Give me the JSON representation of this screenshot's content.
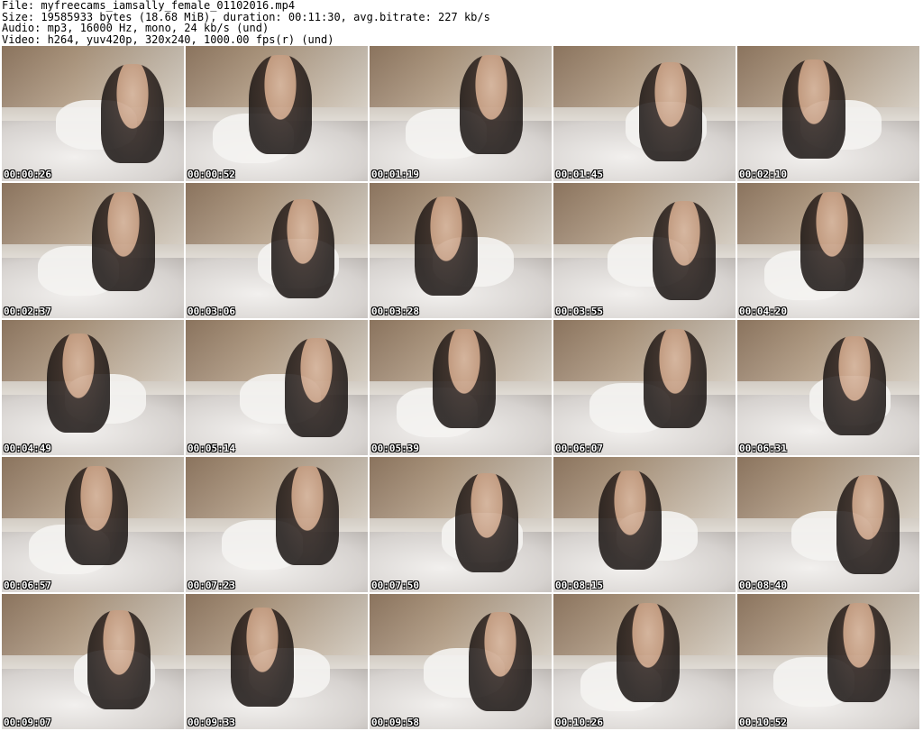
{
  "header": {
    "file": "File: myfreecams_iamsally_female_01102016.mp4",
    "size": "Size: 19585933 bytes (18.68 MiB), duration: 00:11:30, avg.bitrate: 227 kb/s",
    "audio": "Audio: mp3, 16000 Hz, mono, 24 kb/s (und)",
    "video": "Video: h264, yuv420p, 320x240, 1000.00 fps(r) (und)"
  },
  "thumbnails": [
    {
      "timestamp": "00:00:26"
    },
    {
      "timestamp": "00:00:52"
    },
    {
      "timestamp": "00:01:19"
    },
    {
      "timestamp": "00:01:45"
    },
    {
      "timestamp": "00:02:10"
    },
    {
      "timestamp": "00:02:37"
    },
    {
      "timestamp": "00:03:06"
    },
    {
      "timestamp": "00:03:28"
    },
    {
      "timestamp": "00:03:55"
    },
    {
      "timestamp": "00:04:20"
    },
    {
      "timestamp": "00:04:49"
    },
    {
      "timestamp": "00:05:14"
    },
    {
      "timestamp": "00:05:39"
    },
    {
      "timestamp": "00:06:07"
    },
    {
      "timestamp": "00:06:31"
    },
    {
      "timestamp": "00:06:57"
    },
    {
      "timestamp": "00:07:23"
    },
    {
      "timestamp": "00:07:50"
    },
    {
      "timestamp": "00:08:15"
    },
    {
      "timestamp": "00:08:40"
    },
    {
      "timestamp": "00:09:07"
    },
    {
      "timestamp": "00:09:33"
    },
    {
      "timestamp": "00:09:58"
    },
    {
      "timestamp": "00:10:26"
    },
    {
      "timestamp": "00:10:52"
    }
  ]
}
